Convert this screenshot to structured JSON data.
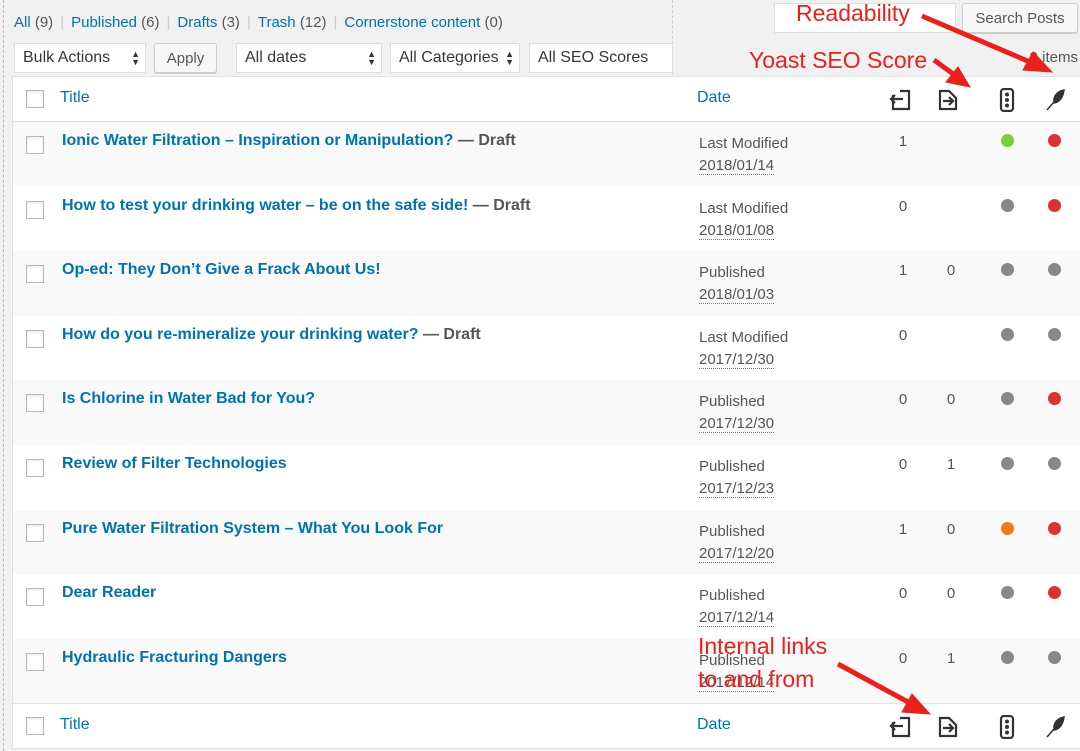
{
  "status_links": [
    {
      "label": "All",
      "count": "(9)"
    },
    {
      "label": "Published",
      "count": "(6)"
    },
    {
      "label": "Drafts",
      "count": "(3)"
    },
    {
      "label": "Trash",
      "count": "(12)"
    },
    {
      "label": "Cornerstone content",
      "count": "(0)"
    }
  ],
  "status_separator": "|",
  "search_button": "Search Posts",
  "search_value": "",
  "filters": {
    "bulk_actions": "Bulk Actions",
    "apply": "Apply",
    "dates": "All dates",
    "categories": "All Categories",
    "seo_scores": "All SEO Scores"
  },
  "item_count": "9 items",
  "table": {
    "col_title": "Title",
    "col_date": "Date",
    "rows": [
      {
        "title": "Ionic Water Filtration – Inspiration or Manipulation?",
        "state": " — Draft",
        "date_label": "Last Modified",
        "date": "2018/01/14",
        "links_to": "1",
        "links_from": "",
        "seo": "#7ad03a",
        "readability": "#dc3232"
      },
      {
        "title": "How to test your drinking water – be on the safe side!",
        "state": " — Draft",
        "date_label": "Last Modified",
        "date": "2018/01/08",
        "links_to": "0",
        "links_from": "",
        "seo": "#888888",
        "readability": "#dc3232"
      },
      {
        "title": "Op-ed: They Don’t Give a Frack About Us!",
        "state": "",
        "date_label": "Published",
        "date": "2018/01/03",
        "links_to": "1",
        "links_from": "0",
        "seo": "#888888",
        "readability": "#888888"
      },
      {
        "title": "How do you re-mineralize your drinking water?",
        "state": " — Draft",
        "date_label": "Last Modified",
        "date": "2017/12/30",
        "links_to": "0",
        "links_from": "",
        "seo": "#888888",
        "readability": "#888888"
      },
      {
        "title": "Is Chlorine in Water Bad for You?",
        "state": "",
        "date_label": "Published",
        "date": "2017/12/30",
        "links_to": "0",
        "links_from": "0",
        "seo": "#888888",
        "readability": "#dc3232"
      },
      {
        "title": "Review of Filter Technologies",
        "state": "",
        "date_label": "Published",
        "date": "2017/12/23",
        "links_to": "0",
        "links_from": "1",
        "seo": "#888888",
        "readability": "#888888"
      },
      {
        "title": "Pure Water Filtration System – What You Look For",
        "state": "",
        "date_label": "Published",
        "date": "2017/12/20",
        "links_to": "1",
        "links_from": "0",
        "seo": "#ee7c1b",
        "readability": "#dc3232"
      },
      {
        "title": "Dear Reader",
        "state": "",
        "date_label": "Published",
        "date": "2017/12/14",
        "links_to": "0",
        "links_from": "0",
        "seo": "#888888",
        "readability": "#dc3232"
      },
      {
        "title": "Hydraulic Fracturing Dangers",
        "state": "",
        "date_label": "Published",
        "date": "2017/12/14",
        "links_to": "0",
        "links_from": "1",
        "seo": "#888888",
        "readability": "#888888"
      }
    ]
  },
  "annotations": {
    "readability": "Readability",
    "seo_score": "Yoast SEO Score",
    "internal_links_line1": "Internal links",
    "internal_links_line2": "to and from"
  },
  "colors": {
    "link": "#0073aa",
    "annotation": "#e8211c"
  },
  "icons": [
    "links-to-icon",
    "links-from-icon",
    "seo-traffic-light-icon",
    "readability-feather-icon"
  ]
}
